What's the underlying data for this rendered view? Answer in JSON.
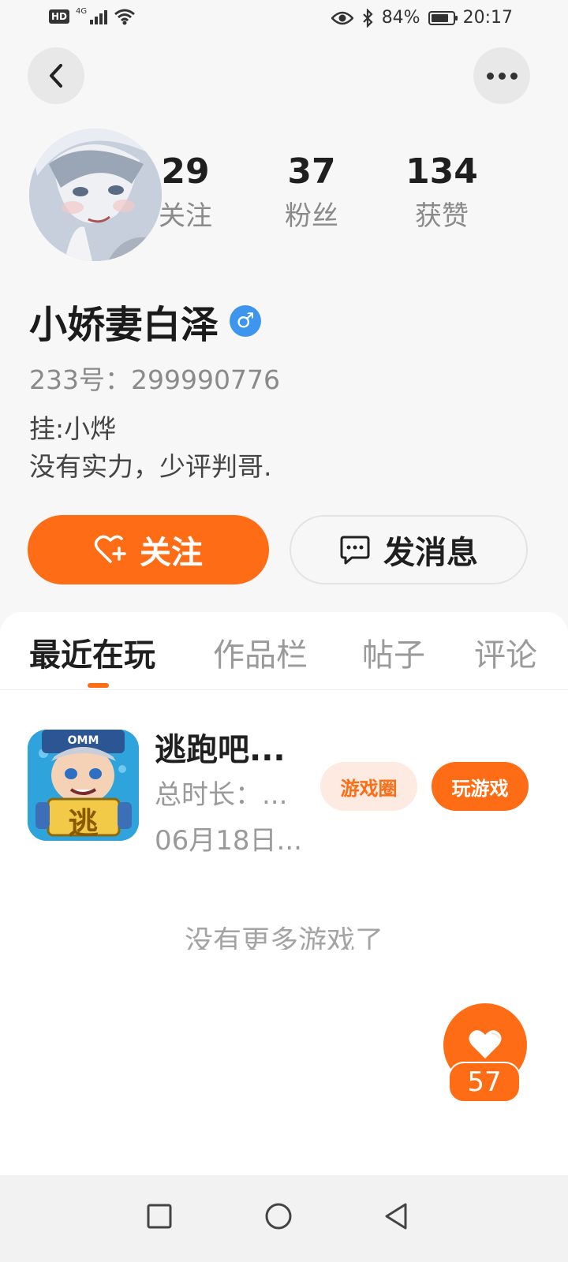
{
  "status_bar": {
    "left_badge": "HD",
    "network_type": "4G",
    "battery_percent": "84%",
    "time": "20:17"
  },
  "header": {
    "back_icon": "chevron-left-icon",
    "more_icon": "more-dots-icon"
  },
  "profile": {
    "stats": [
      {
        "value": "29",
        "label": "关注"
      },
      {
        "value": "37",
        "label": "粉丝"
      },
      {
        "value": "134",
        "label": "获赞"
      }
    ],
    "name": "小娇妻白泽",
    "gender_symbol": "♂",
    "user_id": "233号：299990776",
    "bio_line1": "挂:小烨",
    "bio_line2": "没有实力，少评判哥."
  },
  "actions": {
    "follow_label": "关注",
    "message_label": "发消息"
  },
  "tabs": [
    {
      "label": "最近在玩",
      "active": true
    },
    {
      "label": "作品栏",
      "active": false
    },
    {
      "label": "帖子",
      "active": false
    },
    {
      "label": "评论",
      "active": false
    }
  ],
  "games": [
    {
      "title": "逃跑吧...",
      "total_time": "总时长：...",
      "date": "06月18日...",
      "circle_label": "游戏圈",
      "play_label": "玩游戏",
      "icon_badge_text": "逃",
      "icon_cap_text": "OMM"
    }
  ],
  "empty_hint": "没有更多游戏了",
  "like": {
    "count": "57"
  },
  "colors": {
    "accent": "#fe6d15",
    "accent_light": "#fdeae0",
    "gender_blue": "#3e95ee",
    "background": "#f7f7f7"
  }
}
